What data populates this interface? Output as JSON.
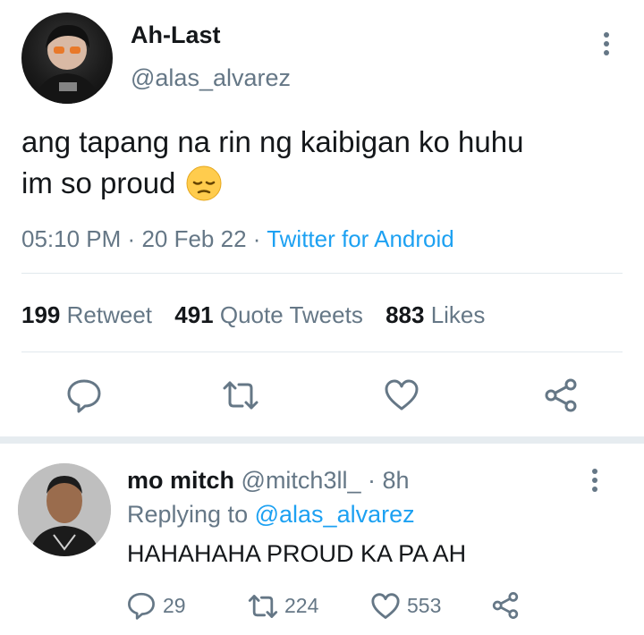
{
  "tweet": {
    "display_name": "Ah-Last",
    "handle": "@alas_alvarez",
    "text_line1": "ang tapang na rin ng kaibigan ko huhu",
    "text_line2": "im so proud",
    "emoji": "pensive-face",
    "time": "05:10 PM",
    "date": "20 Feb 22",
    "source": "Twitter for Android",
    "separator": "·",
    "stats": {
      "retweets": "199",
      "retweets_label": "Retweet",
      "quotes": "491",
      "quotes_label": "Quote Tweets",
      "likes": "883",
      "likes_label": "Likes"
    },
    "actions": [
      "reply-icon",
      "retweet-icon",
      "like-icon",
      "share-icon"
    ]
  },
  "reply": {
    "display_name": "mo mitch",
    "handle": "@mitch3ll_",
    "age": "· 8h",
    "replying_prefix": "Replying to",
    "replying_handle": "@alas_alvarez",
    "text": "HAHAHAHA PROUD KA PA AH",
    "reply_count": "29",
    "retweet_count": "224",
    "like_count": "553"
  },
  "colors": {
    "accent": "#1da1f2",
    "secondary_text": "#657786",
    "divider": "#e1e8ed"
  }
}
